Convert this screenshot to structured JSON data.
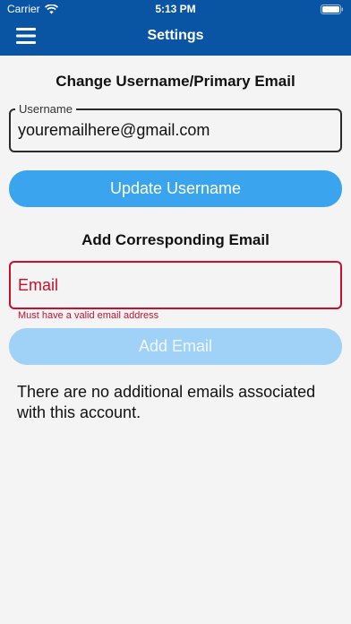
{
  "status_bar": {
    "carrier": "Carrier",
    "time": "5:13 PM"
  },
  "nav": {
    "title": "Settings",
    "menu_icon": "hamburger-menu-icon"
  },
  "change_username": {
    "heading": "Change Username/Primary Email",
    "field_label": "Username",
    "field_value": "youremailhere@gmail.com",
    "button_label": "Update Username"
  },
  "add_email": {
    "heading": "Add Corresponding Email",
    "placeholder": "Email",
    "error": "Must have a valid email address",
    "button_label": "Add Email",
    "info": "There are no additional emails associated with this account."
  },
  "colors": {
    "nav_bg": "#0a55a3",
    "primary_button": "#3aa4ef",
    "disabled_button": "#a0d1f6",
    "error": "#c8102e"
  }
}
